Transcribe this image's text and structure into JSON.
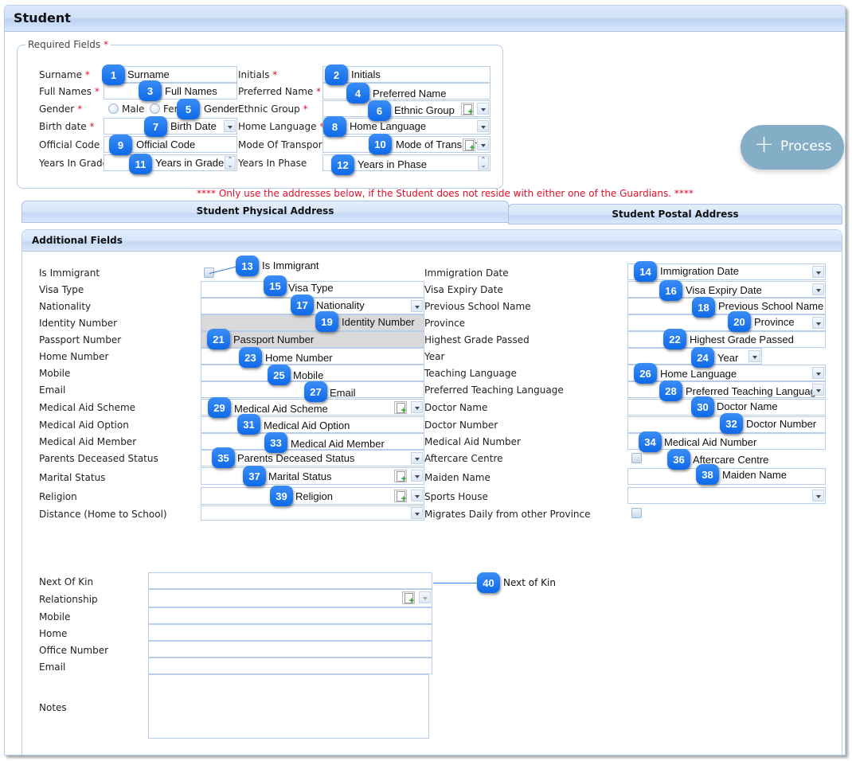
{
  "window": {
    "title": "Student"
  },
  "required": {
    "legend": "Required Fields",
    "required_marker": "*",
    "fields": {
      "surname": {
        "label": "Surname",
        "value": "Surname",
        "callout": "1"
      },
      "initials": {
        "label": "Initials",
        "value": "Initials",
        "callout": "2"
      },
      "full_names": {
        "label": "Full Names",
        "value": "Full Names",
        "callout": "3"
      },
      "preferred_name": {
        "label": "Preferred Name",
        "value": "Preferred Name",
        "callout": "4"
      },
      "gender": {
        "label": "Gender",
        "options": [
          "Male",
          "Female"
        ],
        "visible_option_2": "Fer",
        "callout_text": "Gender",
        "callout": "5"
      },
      "ethnic_group": {
        "label": "Ethnic Group",
        "value": "Ethnic Group",
        "callout": "6"
      },
      "birth_date": {
        "label": "Birth date",
        "value": "Birth Date",
        "callout": "7"
      },
      "home_language": {
        "label": "Home Language",
        "value": "Home Language",
        "callout": "8"
      },
      "official_code": {
        "label": "Official Code",
        "value": "Official Code",
        "callout": "9"
      },
      "mode_of_transport": {
        "label": "Mode Of Transport",
        "value": "Mode of Transport",
        "callout": "10"
      },
      "years_in_grade": {
        "label": "Years In Grade",
        "value": "Years in Grade",
        "callout": "11"
      },
      "years_in_phase": {
        "label": "Years In Phase",
        "value": "Years in Phase",
        "callout": "12"
      }
    }
  },
  "process_button": {
    "label": "Process",
    "icon": "plus-icon"
  },
  "notice": "**** Only use the addresses below, if the Student does not reside with either one of the Guardians. ****",
  "tabs": [
    {
      "label": "Student Physical Address"
    },
    {
      "label": "Student Postal Address"
    }
  ],
  "additional": {
    "title": "Additional Fields",
    "left": [
      {
        "label": "Is Immigrant",
        "value": "Is Immigrant",
        "callout": "13"
      },
      {
        "label": "Visa Type",
        "value": "Visa Type",
        "callout": "15"
      },
      {
        "label": "Nationality",
        "value": "Nationality",
        "callout": "17"
      },
      {
        "label": "Identity Number",
        "value": "Identity Number",
        "callout": "19"
      },
      {
        "label": "Passport Number",
        "value": "Passport Number",
        "callout": "21"
      },
      {
        "label": "Home Number",
        "value": "Home Number",
        "callout": "23"
      },
      {
        "label": "Mobile",
        "value": "Mobile",
        "callout": "25"
      },
      {
        "label": "Email",
        "value": "Email",
        "callout": "27"
      },
      {
        "label": "Medical Aid Scheme",
        "value": "Medical Aid Scheme",
        "callout": "29"
      },
      {
        "label": "Medical Aid Option",
        "value": "Medical Aid Option",
        "callout": "31"
      },
      {
        "label": "Medical Aid Member",
        "value": "Medical Aid Member",
        "callout": "33"
      },
      {
        "label": "Parents Deceased Status",
        "value": "Parents Deceased Status",
        "callout": "35"
      },
      {
        "label": "Marital Status",
        "value": "Marital Status",
        "callout": "37"
      },
      {
        "label": "Religion",
        "value": "Religion",
        "callout": "39"
      },
      {
        "label": "Distance (Home to School)",
        "value": "",
        "callout": ""
      }
    ],
    "right": [
      {
        "label": "Immigration Date",
        "value": "Immigration Date",
        "callout": "14"
      },
      {
        "label": "Visa Expiry Date",
        "value": "Visa Expiry Date",
        "callout": "16"
      },
      {
        "label": "Previous School Name",
        "value": "Previous School Name",
        "callout": "18"
      },
      {
        "label": "Province",
        "value": "Province",
        "callout": "20"
      },
      {
        "label": "Highest Grade Passed",
        "value": "Highest Grade Passed",
        "callout": "22"
      },
      {
        "label": "Year",
        "value": "Year",
        "callout": "24"
      },
      {
        "label": "Teaching Language",
        "value": "Home Language",
        "callout": "26"
      },
      {
        "label": "Preferred Teaching Language",
        "value": "Preferred Teaching Language",
        "callout": "28"
      },
      {
        "label": "Doctor Name",
        "value": "Doctor Name",
        "callout": "30"
      },
      {
        "label": "Doctor Number",
        "value": "Doctor Number",
        "callout": "32"
      },
      {
        "label": "Medical Aid Number",
        "value": "Medical Aid Number",
        "callout": "34"
      },
      {
        "label": "Aftercare Centre",
        "value": "Aftercare Centre",
        "callout": "36"
      },
      {
        "label": "Maiden Name",
        "value": "Maiden Name",
        "callout": "38"
      },
      {
        "label": "Sports House",
        "value": "",
        "callout": ""
      },
      {
        "label": "Migrates Daily from other Province",
        "value": "",
        "callout": ""
      }
    ],
    "next_of_kin": {
      "callout": "40",
      "callout_text": "Next of Kin",
      "fields": [
        {
          "label": "Next Of Kin",
          "value": ""
        },
        {
          "label": "Relationship",
          "value": ""
        },
        {
          "label": "Mobile",
          "value": ""
        },
        {
          "label": "Home",
          "value": ""
        },
        {
          "label": "Office Number",
          "value": ""
        },
        {
          "label": "Email",
          "value": ""
        },
        {
          "label": "Notes",
          "value": ""
        }
      ]
    }
  },
  "colors": {
    "accent": "#1170ea",
    "required": "#e0102b",
    "process_button": "#84aec6",
    "border": "#b8cde8"
  }
}
